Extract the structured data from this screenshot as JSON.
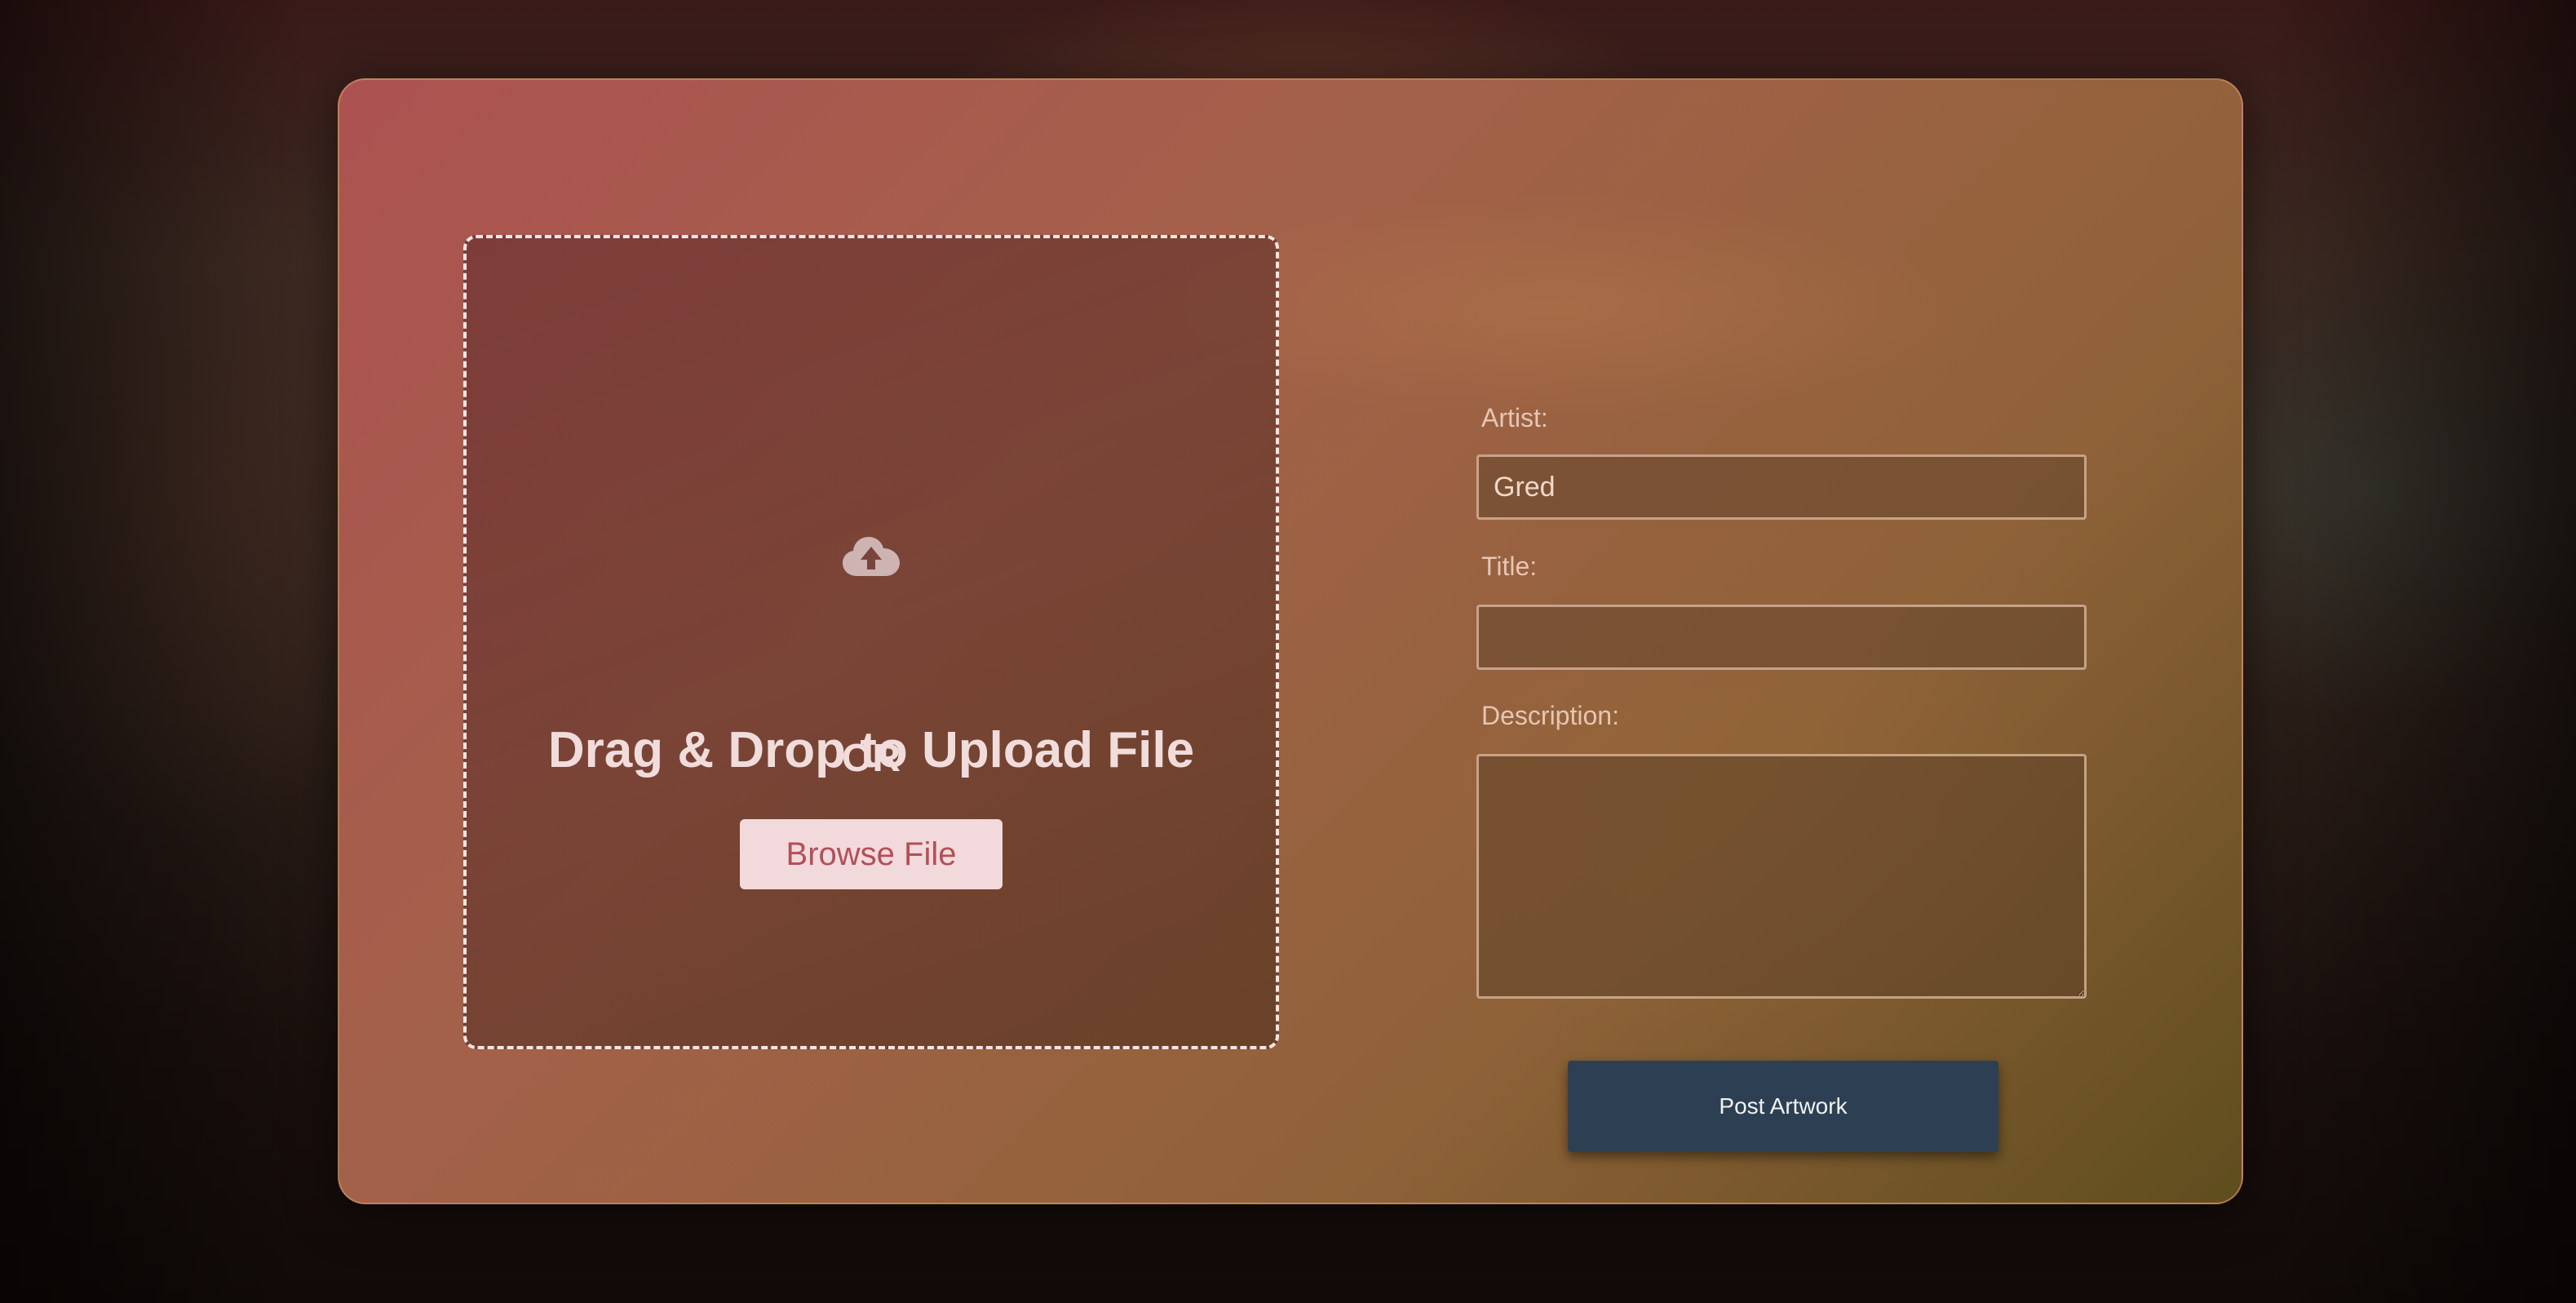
{
  "upload": {
    "title": "Drag & Drop to Upload File",
    "or": "OR",
    "browse_label": "Browse File",
    "icon": "cloud-upload-icon"
  },
  "form": {
    "artist_label": "Artist:",
    "artist_value": "Gred",
    "title_label": "Title:",
    "title_value": "",
    "description_label": "Description:",
    "description_value": "",
    "submit_label": "Post Artwork"
  },
  "colors": {
    "card_gradient_start": "#ac5251",
    "card_gradient_end": "#5f4d1e",
    "browse_button_bg": "#f2d9dc",
    "browse_button_text": "#b25058",
    "submit_button_bg": "#2d4053"
  }
}
